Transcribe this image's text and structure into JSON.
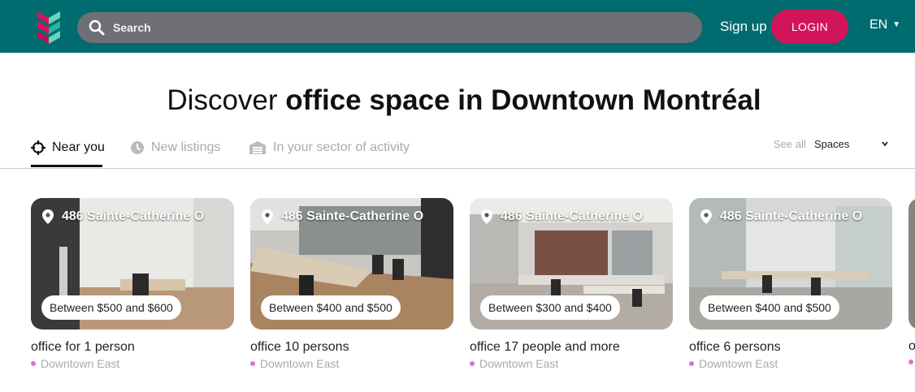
{
  "header": {
    "search_placeholder": "Search",
    "signup_label": "Sign up",
    "login_label": "LOGIN",
    "language": "EN",
    "bg_color": "#006c70",
    "accent_color": "#d2145a"
  },
  "hero": {
    "title_prefix": "Discover ",
    "title_bold": "office space in Downtown Montréal"
  },
  "tabs": [
    {
      "label": "Near you",
      "icon": "crosshair-icon",
      "active": true
    },
    {
      "label": "New listings",
      "icon": "clock-icon",
      "active": false
    },
    {
      "label": "In your sector of activity",
      "icon": "warehouse-icon",
      "active": false
    }
  ],
  "filters": {
    "see_all_label": "See all",
    "spaces_selected": "Spaces"
  },
  "cards": [
    {
      "address": "486 Sainte-Catherine O",
      "price": "Between $500 and $600",
      "title": "office for 1 person",
      "area": "Downtown East"
    },
    {
      "address": "486 Sainte-Catherine O",
      "price": "Between $400 and $500",
      "title": "office 10 persons",
      "area": "Downtown East"
    },
    {
      "address": "486 Sainte-Catherine O",
      "price": "Between $300 and $400",
      "title": "office 17 people and more",
      "area": "Downtown East"
    },
    {
      "address": "486 Sainte-Catherine O",
      "price": "Between $400 and $500",
      "title": "office 6 persons",
      "area": "Downtown East"
    }
  ],
  "partial_card": {
    "title": "o"
  }
}
